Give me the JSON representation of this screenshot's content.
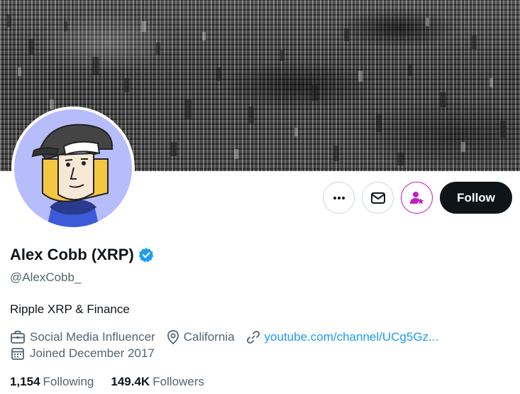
{
  "profile": {
    "display_name": "Alex Cobb (XRP)",
    "handle": "@AlexCobb_",
    "bio": "Ripple XRP & Finance",
    "category": "Social Media Influencer",
    "location": "California",
    "website": "youtube.com/channel/UCg5Gz...",
    "joined": "Joined December 2017",
    "verified": true
  },
  "stats": {
    "following_count": "1,154",
    "following_label": "Following",
    "followers_count": "149.4K",
    "followers_label": "Followers"
  },
  "actions": {
    "follow_label": "Follow"
  },
  "colors": {
    "accent": "#1d9bf0",
    "follow_bg": "#0f1419",
    "notify_ring": "#c01fc3",
    "avatar_bg": "#b7bcfb"
  },
  "icons": {
    "more": "more-horizontal-icon",
    "mail": "envelope-icon",
    "notify": "person-star-icon",
    "category": "briefcase-icon",
    "location": "location-pin-icon",
    "website": "link-icon",
    "joined": "calendar-icon",
    "verified": "verified-badge-icon"
  }
}
